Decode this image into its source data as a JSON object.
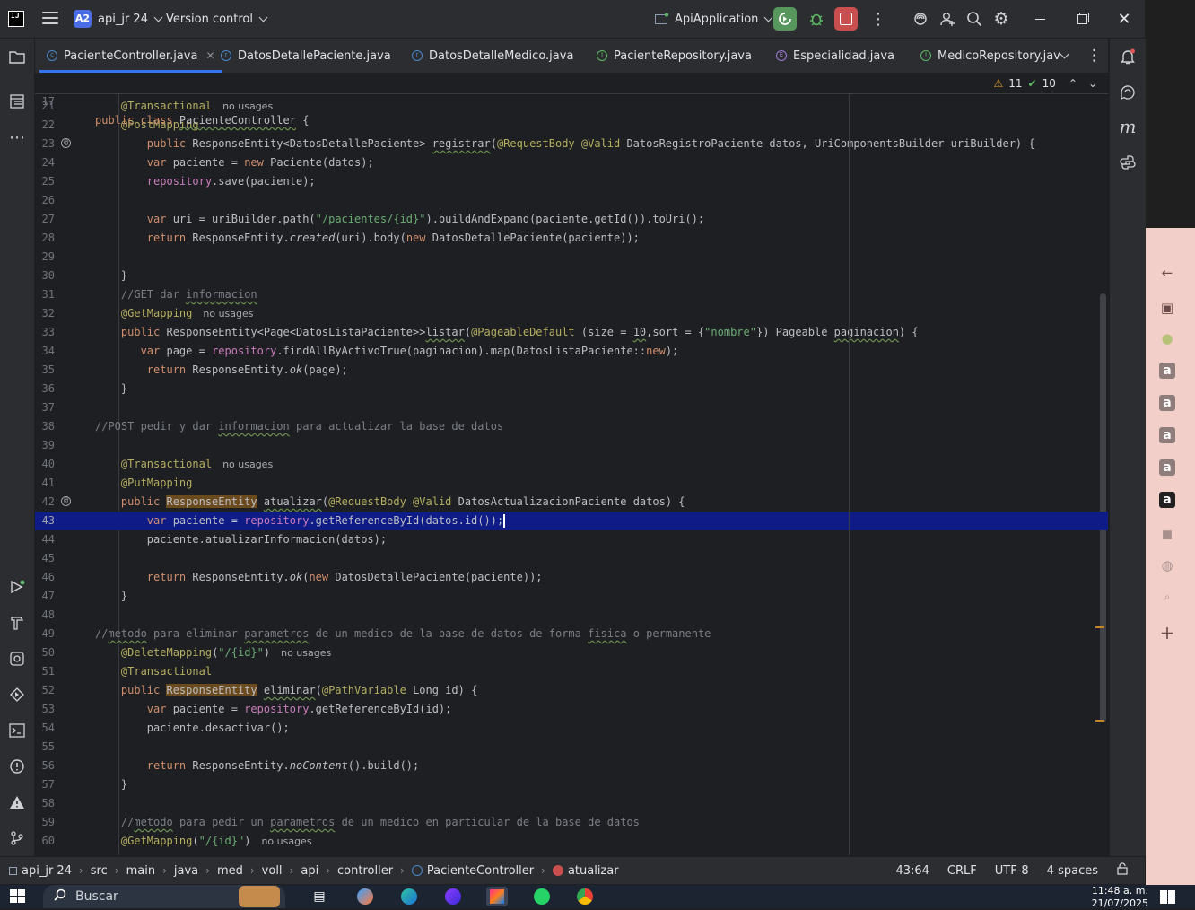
{
  "titlebar": {
    "project_badge": "A2",
    "project_name": "api_jr 24",
    "vcs_label": "Version control",
    "run_config": "ApiApplication"
  },
  "tabs": [
    {
      "label": "PacienteController.java",
      "icon": "class-icon",
      "active": true
    },
    {
      "label": "DatosDetallePaciente.java",
      "icon": "record-icon"
    },
    {
      "label": "DatosDetalleMedico.java",
      "icon": "record-icon"
    },
    {
      "label": "PacienteRepository.java",
      "icon": "interface-icon"
    },
    {
      "label": "Especialidad.java",
      "icon": "enum-icon"
    },
    {
      "label": "MedicoRepository.jav",
      "icon": "interface-icon"
    }
  ],
  "inspections": {
    "warnings": "11",
    "ok": "10"
  },
  "editor": {
    "sticky_line_number": "17",
    "line_numbers": [
      "21",
      "22",
      "23",
      "24",
      "25",
      "26",
      "27",
      "28",
      "29",
      "30",
      "31",
      "32",
      "33",
      "34",
      "35",
      "36",
      "37",
      "38",
      "39",
      "40",
      "41",
      "42",
      "43",
      "44",
      "45",
      "46",
      "47",
      "48",
      "49",
      "50",
      "51",
      "52",
      "53",
      "54",
      "55",
      "56",
      "57",
      "58",
      "59",
      "60"
    ],
    "hints": {
      "no_usages": "no usages"
    }
  },
  "statusbar": {
    "breadcrumbs": [
      "api_jr 24",
      "src",
      "main",
      "java",
      "med",
      "voll",
      "api",
      "controller",
      "PacienteController",
      "atualizar"
    ],
    "position": "43:64",
    "line_sep": "CRLF",
    "encoding": "UTF-8",
    "indent": "4 spaces"
  },
  "taskbar": {
    "search_placeholder": "Buscar",
    "time": "11:48 a. m.",
    "date": "21/07/2025"
  },
  "colors": {
    "accent": "#3574f0",
    "current_line": "#0f1b87",
    "keyword": "#cf8e6d",
    "annotation": "#b3ae60",
    "string": "#6aab73"
  }
}
